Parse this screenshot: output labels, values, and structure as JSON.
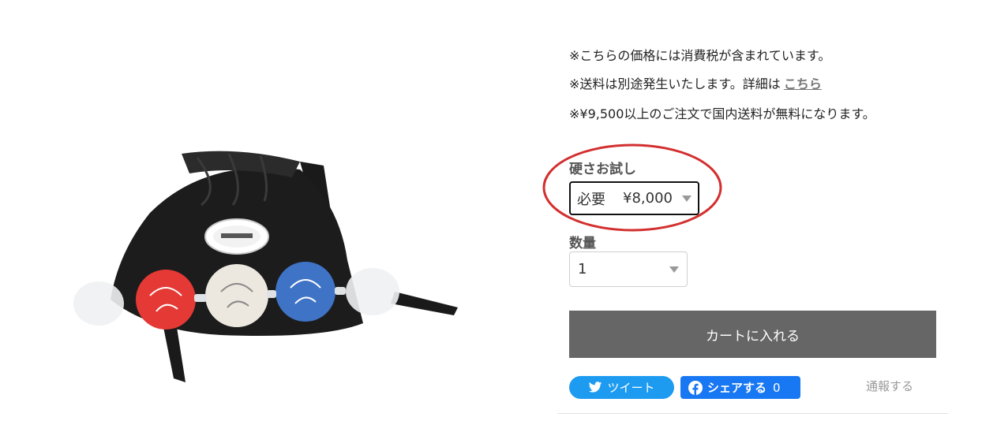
{
  "notices": {
    "tax": "※こちらの価格には消費税が含まれています。",
    "shipping_prefix": "※送料は別途発生いたします。詳細は",
    "shipping_link": "こちら",
    "free_shipping": "※¥9,500以上のご注文で国内送料が無料になります。"
  },
  "hardness": {
    "label": "硬さお試し",
    "selected_option": "必要",
    "selected_price": "¥8,000"
  },
  "quantity": {
    "label": "数量",
    "value": "1"
  },
  "cart_button_label": "カートに入れる",
  "share": {
    "tweet_label": "ツイート",
    "facebook_label": "シェアする",
    "facebook_count": "0"
  },
  "report_label": "通報する",
  "colors": {
    "cart_button": "#666666",
    "twitter": "#1d9bf0",
    "facebook": "#1877f2",
    "annotation": "#d32f2f"
  },
  "icons": [
    "twitter-bird-icon",
    "facebook-icon",
    "chevron-down-icon"
  ]
}
